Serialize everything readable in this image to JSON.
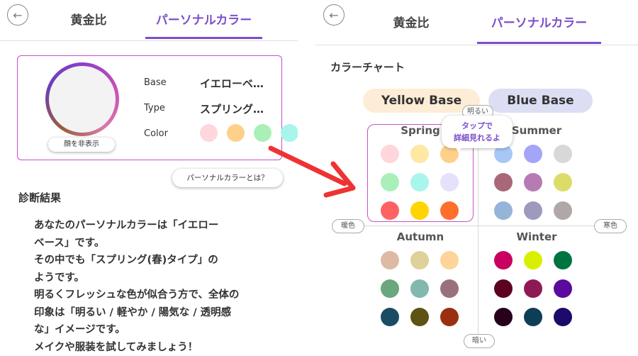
{
  "left": {
    "tabs": [
      {
        "label": "黄金比"
      },
      {
        "label": "パーソナルカラー"
      }
    ],
    "hide_face_label": "顔を非表示",
    "base_label": "Base",
    "base_value": "イエローベ…",
    "type_label": "Type",
    "type_value": "スプリング…",
    "color_label": "Color",
    "colors": [
      "#ffd6dc",
      "#ffd08a",
      "#a8f0b8",
      "#a8f5ec"
    ],
    "what_is_label": "パーソナルカラーとは？",
    "result_title": "診断結果",
    "result_text": "あなたのパーソナルカラーは「イエロー\nベース」です。\nその中でも「スプリング(春)タイプ」の\nようです。\n明るくフレッシュな色が似合う方で、全体の\n印象は「明るい / 軽やか / 陽気な / 透明感\nな」イメージです。\nメイクや服装を試してみましょう！"
  },
  "right": {
    "tabs": [
      {
        "label": "黄金比"
      },
      {
        "label": "パーソナルカラー"
      }
    ],
    "chart_title": "カラーチャート",
    "yellow_base": "Yellow Base",
    "blue_base": "Blue Base",
    "axis_bright": "明るい",
    "axis_dark": "暗い",
    "axis_warm": "暖色",
    "axis_cool": "寒色",
    "callout": "タップで\n詳細見れるよ",
    "seasons": {
      "spring": {
        "name": "Spring",
        "colors": [
          "#ffd6dc",
          "#fee8a3",
          "#ffd08a",
          "#a8f0b8",
          "#a8f5ec",
          "#e6e0fb",
          "#ff6262",
          "#ffd400",
          "#ff6e2b"
        ]
      },
      "summer": {
        "name": "Summer",
        "colors": [
          "#a7c8f7",
          "#a5a5f8",
          "#d8d8d8",
          "#a8687a",
          "#b77bb3",
          "#dcdc68",
          "#95b4d8",
          "#9d9abd",
          "#b0a8a6"
        ]
      },
      "autumn": {
        "name": "Autumn",
        "colors": [
          "#debaa4",
          "#e0d09a",
          "#ffd49a",
          "#6aa67e",
          "#82b8ae",
          "#99717b",
          "#1a4d63",
          "#5e5214",
          "#993010"
        ]
      },
      "winter": {
        "name": "Winter",
        "colors": [
          "#c8005f",
          "#d8f000",
          "#007440",
          "#5d0022",
          "#8e1a55",
          "#5a0a9c",
          "#27001b",
          "#0c3f56",
          "#1e0a6a"
        ]
      }
    },
    "colors": {
      "accent": "#7c4fc9",
      "yellow_base_bg": "#fdedd6",
      "blue_base_bg": "#dcdff3",
      "arrow": "#ee3333"
    }
  }
}
